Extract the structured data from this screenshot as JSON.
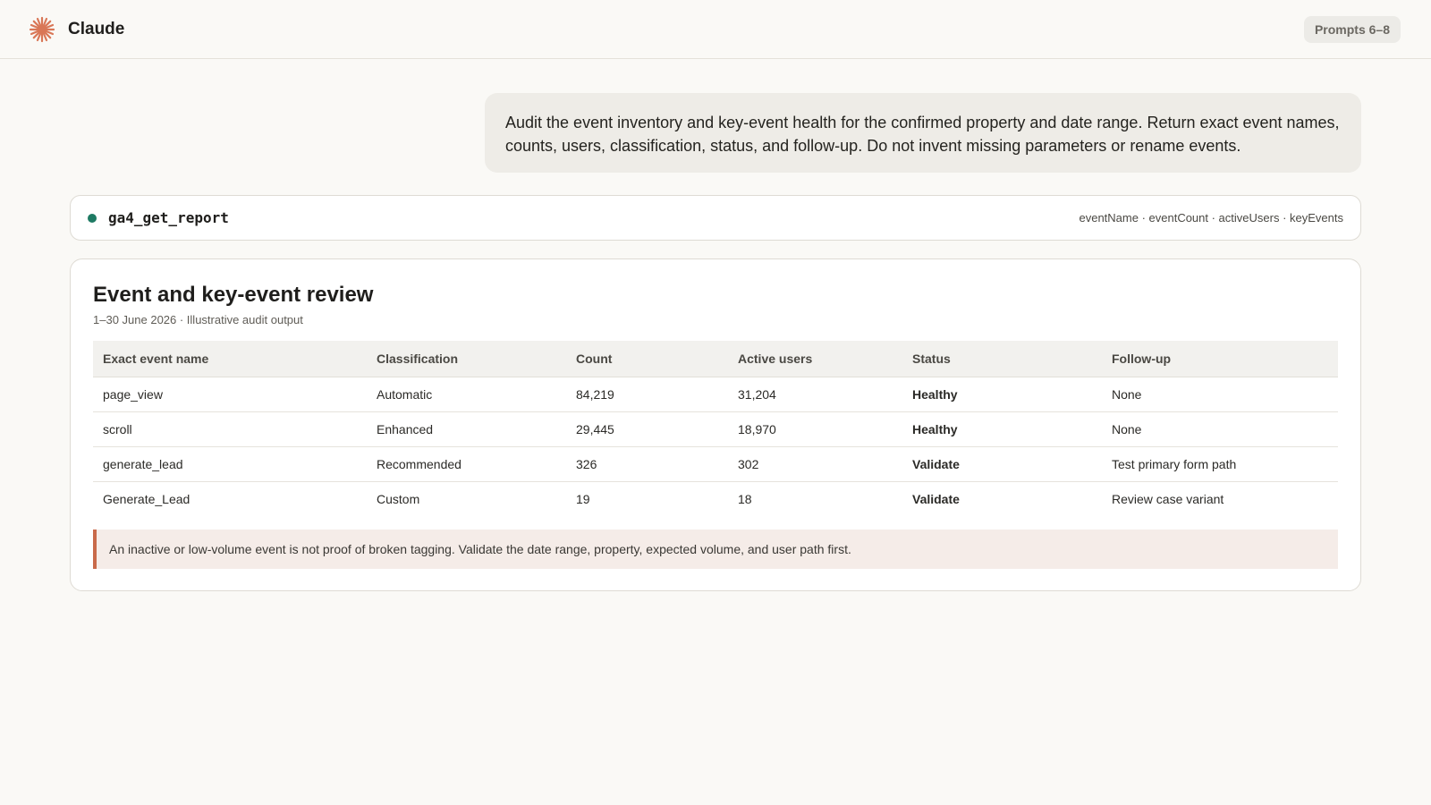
{
  "app": {
    "name": "Claude",
    "badge": "Prompts 6–8"
  },
  "user_message": "Audit the event inventory and key-event health for the confirmed property and date range. Return exact event names, counts, users, classification, status, and follow-up. Do not invent missing parameters or rename events.",
  "tool_call": {
    "name": "ga4_get_report",
    "fields": "eventName · eventCount · activeUsers · keyEvents",
    "status_color": "#1e7a63"
  },
  "report": {
    "title": "Event and key-event review",
    "subtitle": "1–30 June 2026 · Illustrative audit output",
    "columns": [
      "Exact event name",
      "Classification",
      "Count",
      "Active users",
      "Status",
      "Follow-up"
    ],
    "rows": [
      {
        "name": "page_view",
        "classification": "Automatic",
        "count": "84,219",
        "users": "31,204",
        "status": "Healthy",
        "follow_up": "None"
      },
      {
        "name": "scroll",
        "classification": "Enhanced",
        "count": "29,445",
        "users": "18,970",
        "status": "Healthy",
        "follow_up": "None"
      },
      {
        "name": "generate_lead",
        "classification": "Recommended",
        "count": "326",
        "users": "302",
        "status": "Validate",
        "follow_up": "Test primary form path"
      },
      {
        "name": "Generate_Lead",
        "classification": "Custom",
        "count": "19",
        "users": "18",
        "status": "Validate",
        "follow_up": "Review case variant"
      }
    ],
    "callout": "An inactive or low-volume event is not proof of broken tagging. Validate the date range, property, expected volume, and user path first."
  },
  "colors": {
    "accent": "#d97757",
    "healthy": "#1e7a63",
    "validate": "#b0592a"
  },
  "icons": {
    "brand": "claude-spark-icon",
    "tool_status": "status-dot-icon"
  }
}
